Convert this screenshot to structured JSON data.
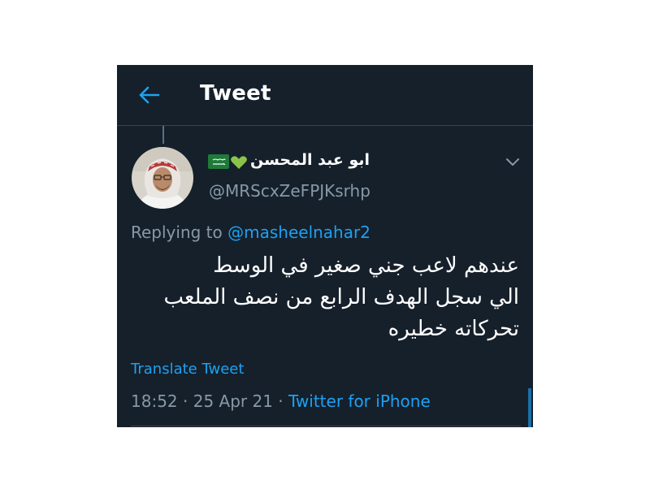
{
  "header": {
    "title": "Tweet",
    "back_icon": "arrow-left-icon"
  },
  "author": {
    "display_name": "ابو عبد المحسن",
    "username": "@MRScxZeFPJKsrhp",
    "badges": [
      "saudi-flag-icon",
      "green-heart-icon"
    ]
  },
  "reply": {
    "prefix": "Replying to",
    "handle": "@masheelnahar2"
  },
  "tweet": {
    "lines": [
      "عندهم لاعب جني صغير في الوسط",
      "الي سجل الهدف الرابع من نصف الملعب",
      "تحركاته خطيره"
    ]
  },
  "translate_label": "Translate Tweet",
  "meta": {
    "time": "18:52",
    "separator": " · ",
    "date": "25 Apr 21",
    "source": "Twitter for iPhone"
  },
  "colors": {
    "background": "#15202b",
    "accent": "#1da1f2",
    "secondary_text": "#8899a6",
    "divider": "#38444d"
  }
}
